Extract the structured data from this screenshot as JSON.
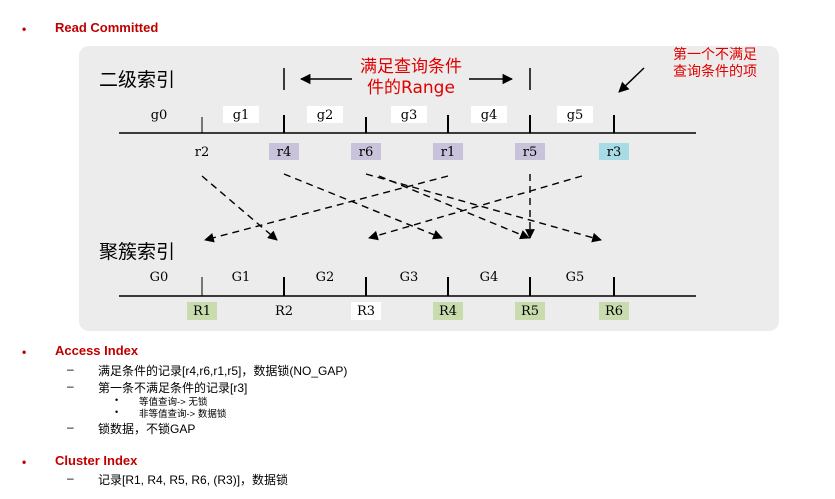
{
  "sections": {
    "read_committed": {
      "bullet": "•",
      "title": "Read Committed"
    },
    "access_index": {
      "bullet": "•",
      "title": "Access Index",
      "items": [
        {
          "dash": "–",
          "text": "满足条件的记录[r4,r6,r1,r5]，数据锁(NO_GAP)"
        },
        {
          "dash": "–",
          "text": "第一条不满足条件的记录[r3]"
        },
        {
          "dash": "–",
          "text": "锁数据，不锁GAP"
        }
      ],
      "subitems": [
        {
          "dot": "•",
          "text": "等值查询-> 无锁"
        },
        {
          "dot": "•",
          "text": "非等值查询-> 数据锁"
        }
      ]
    },
    "cluster_index": {
      "bullet": "•",
      "title": "Cluster Index",
      "items": [
        {
          "dash": "–",
          "text": "记录[R1, R4, R5, R6, (R3)]，数据锁"
        }
      ]
    }
  },
  "diagram": {
    "secondary_index_title": "二级索引",
    "cluster_index_title": "聚簇索引",
    "range_label_line1": "满足查询条件",
    "range_label_line2": "件的Range",
    "first_unmatched_line1": "第一个不满足",
    "first_unmatched_line2": "查询条件的项",
    "secondary_gaps": [
      "g0",
      "g1",
      "g2",
      "g3",
      "g4",
      "g5"
    ],
    "secondary_records": [
      "r2",
      "r4",
      "r6",
      "r1",
      "r5",
      "r3"
    ],
    "cluster_gaps": [
      "G0",
      "G1",
      "G2",
      "G3",
      "G4",
      "G5"
    ],
    "cluster_records": [
      "R1",
      "R2",
      "R3",
      "R4",
      "R5",
      "R6"
    ],
    "colors": {
      "red": "#e00000",
      "purple_box": "#c9c2db",
      "blue_box": "#a9dbe6",
      "green_box": "#c8dcae",
      "white_box": "#ffffff",
      "panel": "#ececec"
    }
  }
}
